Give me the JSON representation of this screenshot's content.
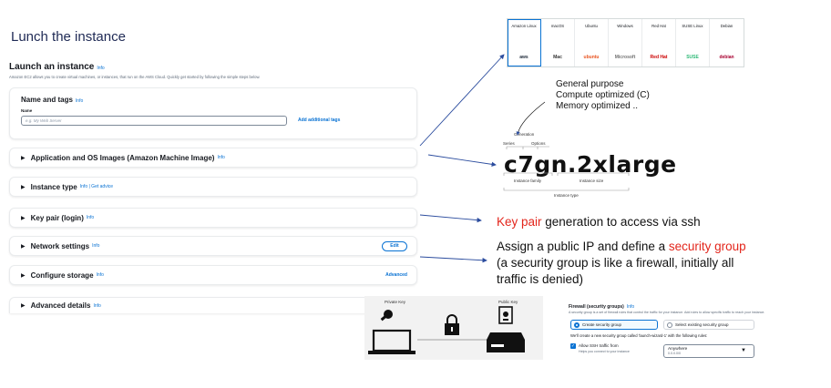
{
  "slide_title": "Lunch the instance",
  "console": {
    "heading": "Launch an instance",
    "info": "Info",
    "subtitle": "Amazon EC2 allows you to create virtual machines, or instances, that run on the AWS Cloud. Quickly get started by following the simple steps below.",
    "name_tags": {
      "title": "Name and tags",
      "info": "Info",
      "field_label": "Name",
      "placeholder": "e.g. My Web Server",
      "add_tags": "Add additional tags"
    },
    "sections": {
      "ami": {
        "title": "Application and OS Images (Amazon Machine Image)",
        "info": "Info"
      },
      "instance_type": {
        "title": "Instance type",
        "info": "Info | Get advice"
      },
      "key_pair": {
        "title": "Key pair (login)",
        "info": "Info"
      },
      "network": {
        "title": "Network settings",
        "info": "Info",
        "action": "Edit"
      },
      "storage": {
        "title": "Configure storage",
        "info": "Info",
        "action": "Advanced"
      },
      "advanced": {
        "title": "Advanced details",
        "info": "Info"
      }
    }
  },
  "os_images": [
    {
      "name": "Amazon Linux",
      "logo": "aws",
      "logo_color": "#232f3e"
    },
    {
      "name": "macOS",
      "logo": "Mac",
      "logo_color": "#333333"
    },
    {
      "name": "Ubuntu",
      "logo": "ubuntu",
      "logo_color": "#e95420"
    },
    {
      "name": "Windows",
      "logo": "Microsoft",
      "logo_color": "#737373"
    },
    {
      "name": "Red Hat",
      "logo": "Red Hat",
      "logo_color": "#cc0000"
    },
    {
      "name": "SUSE Linux",
      "logo": "SUSE",
      "logo_color": "#30ba78"
    },
    {
      "name": "Debian",
      "logo": "debian",
      "logo_color": "#a80030"
    }
  ],
  "instance_type_explainer": {
    "purposes": [
      "General purpose",
      "Compute optimized (C)",
      "Memory optimized .."
    ],
    "generation": "Generation",
    "series": "Series",
    "options": "Options",
    "type_name": "c7gn.2xlarge",
    "family": "Instance family",
    "size": "Instance size",
    "instance_type": "Instance type"
  },
  "key_pair_note": {
    "highlight": "Key pair",
    "rest": " generation to access via ssh"
  },
  "network_note": {
    "line1_a": "Assign a public IP and define a ",
    "line1_highlight": "security group",
    "line2": "(a security group is like a firewall, initially all",
    "line3": "traffic is denied)"
  },
  "key_diagram": {
    "private_key": "Private Key",
    "public_key": "Public Key"
  },
  "security_group": {
    "title": "Firewall (security groups)",
    "info": "Info",
    "desc": "A security group is a set of firewall rules that control the traffic for your instance. Add rules to allow specific traffic to reach your instance.",
    "option_create": "Create security group",
    "option_existing": "Select existing security group",
    "note": "We'll create a new security group called 'launch-wizard-1' with the following rules:",
    "allow_ssh": "Allow SSH traffic from",
    "allow_ssh_help": "Helps you connect to your instance",
    "source": "Anywhere",
    "source_cidr": "0.0.0.0/0"
  },
  "colors": {
    "accent": "#0972d3",
    "highlight": "#e3261c",
    "arrow": "#2b4c9e"
  }
}
